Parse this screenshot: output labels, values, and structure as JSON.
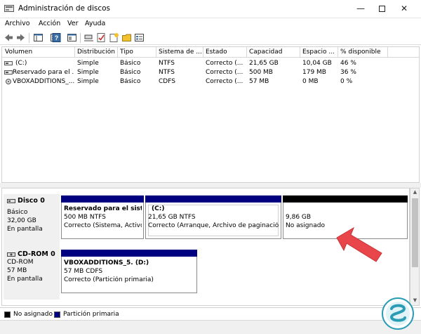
{
  "window": {
    "title": "Administración de discos",
    "controls": [
      "—",
      "✕"
    ]
  },
  "menu": [
    "Archivo",
    "Acción",
    "Ver",
    "Ayuda"
  ],
  "toolbar_icons": [
    "back-icon",
    "forward-icon",
    "console-tree-icon",
    "properties-icon",
    "help-icon",
    "show-pane-icon",
    "connect-icon",
    "check-icon",
    "new-icon",
    "open-icon",
    "settings-icon"
  ],
  "volumes": {
    "columns": [
      "Volumen",
      "Distribución",
      "Tipo",
      "Sistema de ...",
      "Estado",
      "Capacidad",
      "Espacio ...",
      "% disponible"
    ],
    "rows": [
      [
        "(C:)",
        "Simple",
        "Básico",
        "NTFS",
        "Correcto (...",
        "21,65 GB",
        "10,04 GB",
        "46 %"
      ],
      [
        "Reservado para el ...",
        "Simple",
        "Básico",
        "NTFS",
        "Correcto (...",
        "500 MB",
        "179 MB",
        "36 %"
      ],
      [
        "VBOXADDITIONS_...",
        "Simple",
        "Básico",
        "CDFS",
        "Correcto (...",
        "57 MB",
        "0 MB",
        "0 %"
      ]
    ]
  },
  "disks": [
    {
      "name": "Disco 0",
      "lines": [
        "Básico",
        "32,00 GB",
        "En pantalla"
      ],
      "partitions": [
        {
          "title": "Reservado para el sistem",
          "size": "500 MB NTFS",
          "status": "Correcto (Sistema, Activo,"
        },
        {
          "title": "(C:)",
          "size": "21,65 GB NTFS",
          "status": "Correcto (Arranque, Archivo de paginación,"
        },
        {
          "title": "",
          "size": "9,86 GB",
          "status": "No asignado"
        }
      ]
    },
    {
      "name": "CD-ROM 0",
      "lines": [
        "CD-ROM",
        "57 MB",
        "En pantalla"
      ],
      "partitions": [
        {
          "title": "VBOXADDITIONS_5.  (D:)",
          "size": "57 MB CDFS",
          "status": "Correcto (Partición primaria)"
        }
      ]
    }
  ],
  "legend": [
    {
      "label": "No asignado",
      "color": "#000000"
    },
    {
      "label": "Partición primaria",
      "color": "#000080"
    }
  ],
  "colors": {
    "primary_partition": "#000080",
    "unallocated": "#000000",
    "arrow": "#e8464a"
  }
}
